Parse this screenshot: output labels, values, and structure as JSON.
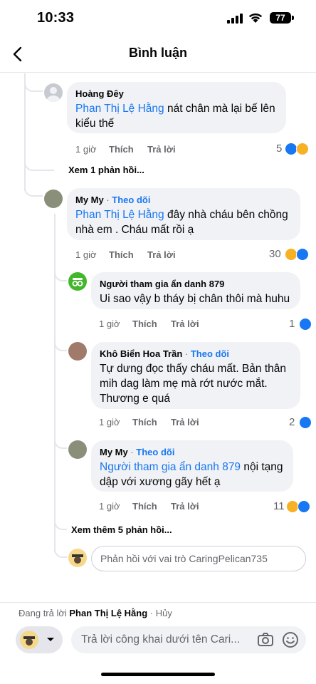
{
  "status_bar": {
    "time": "10:33",
    "battery": "77"
  },
  "header": {
    "title": "Bình luận"
  },
  "comments": [
    {
      "author": "Hoàng Đêy",
      "mention": "Phan Thị Lệ Hằng",
      "text_line1": " nát chân mà lại bế lên",
      "text_line2": "kiểu thế",
      "time": "1 giờ",
      "like": "Thích",
      "reply": "Trả lời",
      "reaction_count": "5",
      "reactions": [
        "like-icon",
        "sad-icon"
      ]
    },
    {
      "author": "My My",
      "dot": " · ",
      "follow": "Theo dõi",
      "mention": "Phan Thị Lệ Hằng",
      "text_line1": " đây nhà cháu bên chồng",
      "text_line2": "nhà em . Cháu mất rồi ạ",
      "time": "1 giờ",
      "like": "Thích",
      "reply": "Trả lời",
      "reaction_count": "30",
      "reactions": [
        "sad-icon",
        "like-icon"
      ]
    },
    {
      "author": "Người tham gia ẩn danh 879",
      "text_line1": "Ui sao vậy b tháy bị chân thôi mà huhu",
      "time": "1 giờ",
      "like": "Thích",
      "reply": "Trả lời",
      "reaction_count": "1",
      "reactions": [
        "like-icon"
      ]
    },
    {
      "author": "Khô Biển Hoa Trần",
      "dot": " · ",
      "follow": "Theo dõi",
      "text_line1": "Tự dưng đọc thấy cháu mất. Bản thân",
      "text_line2": "mih dag làm mẹ mà rớt nước mắt.",
      "text_line3": "Thương e quá",
      "time": "1 giờ",
      "like": "Thích",
      "reply": "Trả lời",
      "reaction_count": "2",
      "reactions": [
        "like-icon"
      ]
    },
    {
      "author": "My My",
      "dot": " · ",
      "follow": "Theo dõi",
      "mention": "Người tham gia ẩn danh 879",
      "text_line1": " nội tạng",
      "text_line2": "dập với xương gãy hết ạ",
      "time": "1 giờ",
      "like": "Thích",
      "reply": "Trả lời",
      "reaction_count": "11",
      "reactions": [
        "sad-icon",
        "like-icon"
      ]
    }
  ],
  "view_replies_1": "Xem 1 phản hồi...",
  "view_more_replies": "Xem thêm 5 phản hồi...",
  "thread_reply_placeholder": "Phản hồi với vai trò CaringPelican735",
  "composer": {
    "replying_prefix": "Đang trả lời ",
    "replying_to": "Phan Thị Lệ Hằng",
    "cancel": " · Hủy",
    "placeholder": "Trả lời công khai dưới tên Cari..."
  },
  "colors": {
    "accent": "#1877f2",
    "bubble": "#f0f2f5",
    "muted": "#65676b"
  }
}
